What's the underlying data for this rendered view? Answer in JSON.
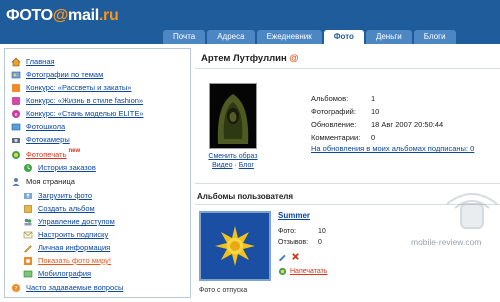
{
  "logo": {
    "text_a": "ФОТО",
    "at": "@",
    "text_b": "mail",
    "ru": ".ru"
  },
  "tabs": [
    {
      "label": "Почта"
    },
    {
      "label": "Адреса"
    },
    {
      "label": "Ежедневник"
    },
    {
      "label": "Фото",
      "active": true
    },
    {
      "label": "Деньги"
    },
    {
      "label": "Блоги"
    }
  ],
  "sidebar": {
    "items": [
      {
        "label": "Главная",
        "icon": "home-icon"
      },
      {
        "label": "Фотографии по темам",
        "icon": "photos-icon"
      },
      {
        "label": "Конкурс: «Рассветы и закаты»",
        "icon": "contest-icon"
      },
      {
        "label": "Конкурс: «Жизнь в стиле fashion»",
        "icon": "contest-icon"
      },
      {
        "label": "Конкурс: «Стань моделью ELITE»",
        "icon": "contest-icon"
      },
      {
        "label": "Фотошкола",
        "icon": "school-icon"
      },
      {
        "label": "Фотокамеры",
        "icon": "camera-icon"
      },
      {
        "label": "Фотопечать",
        "icon": "print-icon",
        "badge": "new"
      },
      {
        "label": "История заказов",
        "icon": "history-icon"
      },
      {
        "label": "Моя страница",
        "icon": "person-icon"
      },
      {
        "label": "Загрузить фото",
        "icon": "upload-icon"
      },
      {
        "label": "Создать альбом",
        "icon": "album-icon"
      },
      {
        "label": "Управление доступом",
        "icon": "access-icon"
      },
      {
        "label": "Настроить подписку",
        "icon": "subscription-icon"
      },
      {
        "label": "Личная информация",
        "icon": "info-icon"
      },
      {
        "label": "Показать фото миру!",
        "icon": "share-icon"
      },
      {
        "label": "Мобилография",
        "icon": "mobile-icon"
      },
      {
        "label": "Часто задаваемые вопросы",
        "icon": "faq-icon"
      }
    ]
  },
  "profile": {
    "name": "Артем Лутфуллин",
    "at": "@",
    "change_avatar": "Сменить образ",
    "video": "Видео",
    "dot": "·",
    "blog": "Блог",
    "stats": [
      {
        "k": "Альбомов:",
        "v": "1"
      },
      {
        "k": "Фотографий:",
        "v": "10"
      },
      {
        "k": "Обновление:",
        "v": "18 Авг 2007 20:50:44"
      },
      {
        "k": "Комментарии:",
        "v": "0"
      }
    ],
    "subscribe_link": "На обновления в моих альбомах подписаны: 0"
  },
  "albums": {
    "title": "Альбомы пользователя",
    "items": [
      {
        "name": "Summer",
        "photos_k": "Фото:",
        "photos_v": "10",
        "reviews_k": "Отзывов:",
        "reviews_v": "0",
        "print_label": "Напечатать",
        "caption": "Фото с отпуска"
      }
    ]
  },
  "watermark": "mobile-review.com",
  "colors": {
    "header": "#1f5c9c",
    "tab": "#4d87c3",
    "link": "#0b47a0",
    "accent": "#e8571c",
    "red": "#d8341b"
  }
}
